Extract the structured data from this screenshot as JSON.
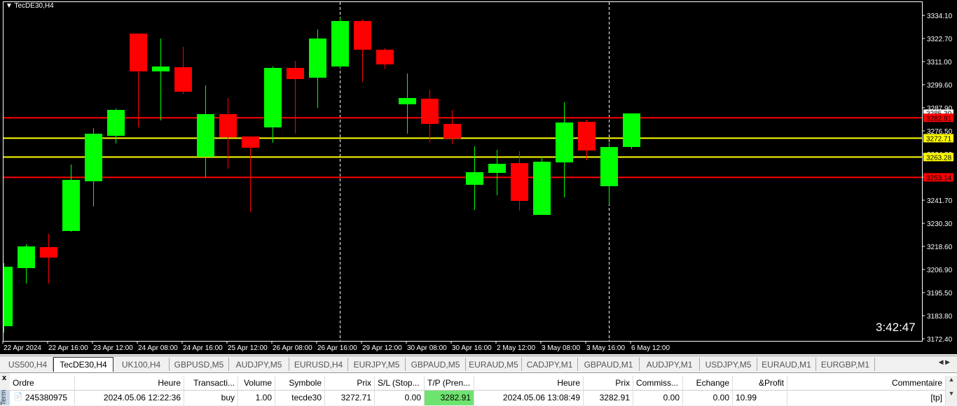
{
  "chart": {
    "title": "TecDE30,H4",
    "countdown": "3:42:47",
    "price_axis": [
      "3334.10",
      "3322.70",
      "3311.00",
      "3299.60",
      "3287.90",
      "3276.50",
      "3264.80",
      "3253.40",
      "3241.70",
      "3230.30",
      "3218.60",
      "3206.90",
      "3195.50",
      "3183.80",
      "3172.40"
    ],
    "price_range": [
      3172.4,
      3334.1
    ],
    "time_axis": [
      "22 Apr 2024",
      "22 Apr 16:00",
      "23 Apr 12:00",
      "24 Apr 08:00",
      "24 Apr 16:00",
      "25 Apr 12:00",
      "26 Apr 08:00",
      "26 Apr 16:00",
      "29 Apr 12:00",
      "30 Apr 08:00",
      "30 Apr 16:00",
      "2 May 12:00",
      "3 May 08:00",
      "3 May 16:00",
      "6 May 12:00"
    ],
    "current_price": "3285.30",
    "levels": [
      {
        "price": 3282.91,
        "label": "3282.91",
        "color": "#ff0000"
      },
      {
        "price": 3272.71,
        "label": "3272.71",
        "color": "#ffff00"
      },
      {
        "price": 3263.28,
        "label": "3263.28",
        "color": "#ffff00"
      },
      {
        "price": 3253.14,
        "label": "3253.14",
        "color": "#ff0000"
      }
    ],
    "colors": {
      "bull": "#00ff00",
      "bear": "#ff0000"
    },
    "candles": [
      [
        3178.7,
        3210.2,
        3175.55,
        3208.45
      ],
      [
        3207.75,
        3219.65,
        3200.05,
        3218.6
      ],
      [
        3218.25,
        3224.9,
        3200.05,
        3213.0
      ],
      [
        3226.3,
        3259.55,
        3225.95,
        3251.85
      ],
      [
        3251.15,
        3277.75,
        3238.55,
        3274.95
      ],
      [
        3273.9,
        3287.55,
        3270.05,
        3286.85
      ],
      [
        3325.0,
        3325.0,
        3278.1,
        3306.1
      ],
      [
        3306.1,
        3322.55,
        3281.6,
        3308.55
      ],
      [
        3308.2,
        3318.35,
        3294.9,
        3295.95
      ],
      [
        3263.4,
        3299.1,
        3253.25,
        3284.75
      ],
      [
        3284.75,
        3292.8,
        3257.45,
        3273.2
      ],
      [
        3273.55,
        3273.55,
        3235.75,
        3267.95
      ],
      [
        3278.1,
        3308.55,
        3270.4,
        3307.85
      ],
      [
        3307.85,
        3311.35,
        3274.95,
        3302.25
      ],
      [
        3302.95,
        3327.1,
        3287.9,
        3322.55
      ],
      [
        3308.55,
        3333.05,
        3307.85,
        3331.3
      ],
      [
        3331.3,
        3332.0,
        3300.85,
        3316.95
      ],
      [
        3316.95,
        3317.65,
        3307.15,
        3309.6
      ],
      [
        3289.65,
        3305.05,
        3274.95,
        3292.8
      ],
      [
        3292.45,
        3297.0,
        3270.4,
        3279.85
      ],
      [
        3279.85,
        3286.85,
        3269.7,
        3272.5
      ],
      [
        3249.4,
        3268.65,
        3236.8,
        3255.7
      ],
      [
        3255.35,
        3266.9,
        3244.15,
        3259.9
      ],
      [
        3260.25,
        3266.2,
        3236.45,
        3241.35
      ],
      [
        3234.35,
        3263.4,
        3234.35,
        3260.95
      ],
      [
        3260.6,
        3290.7,
        3243.1,
        3280.55
      ],
      [
        3280.9,
        3281.95,
        3261.65,
        3266.55
      ],
      [
        3248.7,
        3270.4,
        3239.6,
        3268.3
      ],
      [
        3268.3,
        3285.1,
        3267.25,
        3285.1
      ]
    ],
    "period_separators_at_candle": [
      15,
      27
    ]
  },
  "tabs": [
    "US500,H4",
    "TecDE30,H4",
    "UK100,H4",
    "GBPUSD,M5",
    "AUDJPY,M5",
    "EURUSD,H4",
    "EURJPY,M5",
    "GBPAUD,M5",
    "EURAUD,M5",
    "CADJPY,M1",
    "GBPAUD,M1",
    "AUDJPY,M1",
    "USDJPY,M5",
    "EURAUD,M1",
    "EURGBP,M1"
  ],
  "active_tab": 1,
  "terminal": {
    "side_label": "Terminal",
    "close": "x",
    "headers": [
      "Ordre",
      "Heure",
      "Transacti...",
      "Volume",
      "Symbole",
      "Prix",
      "S/L (Stop...",
      "T/P (Pren...",
      "Heure",
      "Prix",
      "Commiss...",
      "Echange",
      "&Profit",
      "Commentaire"
    ],
    "row": [
      "245380975",
      "2024.05.06 12:22:36",
      "buy",
      "1.00",
      "tecde30",
      "3272.71",
      "0.00",
      "3282.91",
      "2024.05.06 13:08:49",
      "3282.91",
      "0.00",
      "0.00",
      "10.99",
      "[tp]"
    ]
  }
}
